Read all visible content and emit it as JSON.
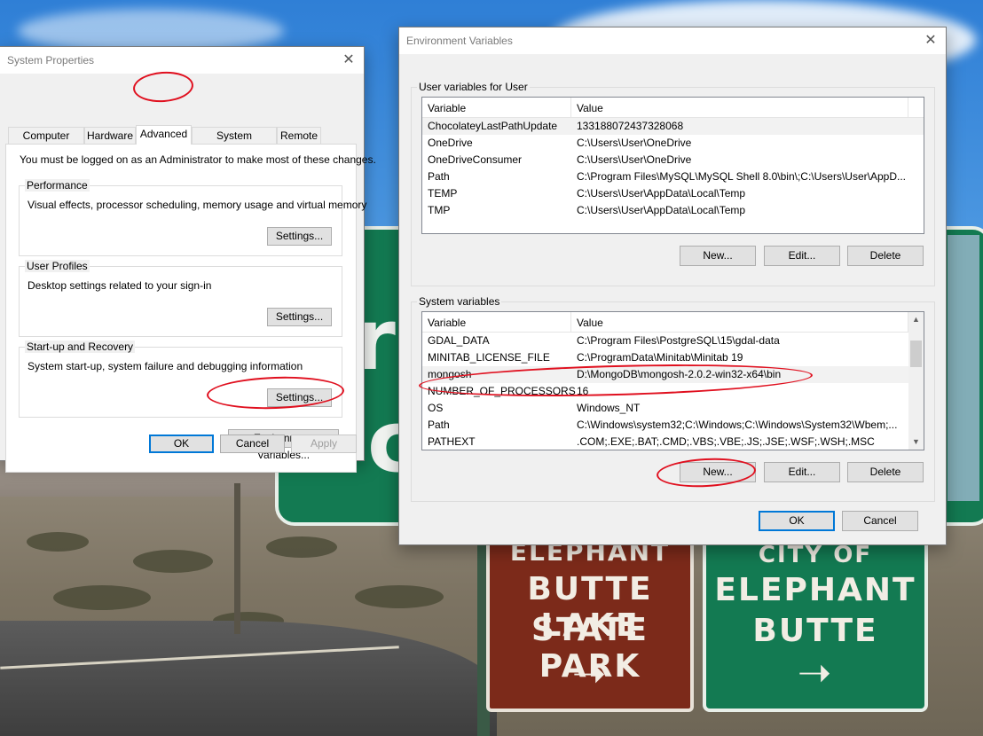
{
  "system_properties": {
    "title": "System Properties",
    "close_icon": "close-icon",
    "tabs": [
      {
        "label": "Computer Name"
      },
      {
        "label": "Hardware"
      },
      {
        "label": "Advanced"
      },
      {
        "label": "System Protection"
      },
      {
        "label": "Remote"
      }
    ],
    "active_tab": "Advanced",
    "admin_notice": "You must be logged on as an Administrator to make most of these changes.",
    "performance": {
      "label": "Performance",
      "description": "Visual effects, processor scheduling, memory usage and virtual memory",
      "settings_label": "Settings..."
    },
    "user_profiles": {
      "label": "User Profiles",
      "description": "Desktop settings related to your sign-in",
      "settings_label": "Settings..."
    },
    "startup_recovery": {
      "label": "Start-up and Recovery",
      "description": "System start-up, system failure and debugging information",
      "settings_label": "Settings..."
    },
    "env_vars_label": "Environment Variables...",
    "ok_label": "OK",
    "cancel_label": "Cancel",
    "apply_label": "Apply"
  },
  "environment_variables": {
    "title": "Environment Variables",
    "close_icon": "close-icon",
    "user_section": {
      "label": "User variables for User",
      "col_variable": "Variable",
      "col_value": "Value",
      "rows": [
        {
          "name": "ChocolateyLastPathUpdate",
          "value": "133188072437328068"
        },
        {
          "name": "OneDrive",
          "value": "C:\\Users\\User\\OneDrive"
        },
        {
          "name": "OneDriveConsumer",
          "value": "C:\\Users\\User\\OneDrive"
        },
        {
          "name": "Path",
          "value": "C:\\Program Files\\MySQL\\MySQL Shell 8.0\\bin\\;C:\\Users\\User\\AppD..."
        },
        {
          "name": "TEMP",
          "value": "C:\\Users\\User\\AppData\\Local\\Temp"
        },
        {
          "name": "TMP",
          "value": "C:\\Users\\User\\AppData\\Local\\Temp"
        }
      ],
      "selected_row": 0,
      "new_label": "New...",
      "edit_label": "Edit...",
      "delete_label": "Delete"
    },
    "system_section": {
      "label": "System variables",
      "col_variable": "Variable",
      "col_value": "Value",
      "rows": [
        {
          "name": "GDAL_DATA",
          "value": "C:\\Program Files\\PostgreSQL\\15\\gdal-data"
        },
        {
          "name": "MINITAB_LICENSE_FILE",
          "value": "C:\\ProgramData\\Minitab\\Minitab 19"
        },
        {
          "name": "mongosh",
          "value": "D:\\MongoDB\\mongosh-2.0.2-win32-x64\\bin"
        },
        {
          "name": "NUMBER_OF_PROCESSORS",
          "value": "16"
        },
        {
          "name": "OS",
          "value": "Windows_NT"
        },
        {
          "name": "Path",
          "value": "C:\\Windows\\system32;C:\\Windows;C:\\Windows\\System32\\Wbem;..."
        },
        {
          "name": "PATHEXT",
          "value": ".COM;.EXE;.BAT;.CMD;.VBS;.VBE;.JS;.JSE;.WSF;.WSH;.MSC"
        }
      ],
      "selected_row": 2,
      "new_label": "New...",
      "edit_label": "Edit...",
      "delete_label": "Delete",
      "scroll_up_icon": "chevron-up-icon",
      "scroll_down_icon": "chevron-down-icon"
    },
    "ok_label": "OK",
    "cancel_label": "Cancel"
  },
  "background_signs": {
    "brown_sign_lines": [
      "ELEPHANT",
      "BUTTE LAKE",
      "STATE PARK"
    ],
    "green_sign_lines": [
      "CITY OF",
      "ELEPHANT",
      "BUTTE"
    ]
  }
}
